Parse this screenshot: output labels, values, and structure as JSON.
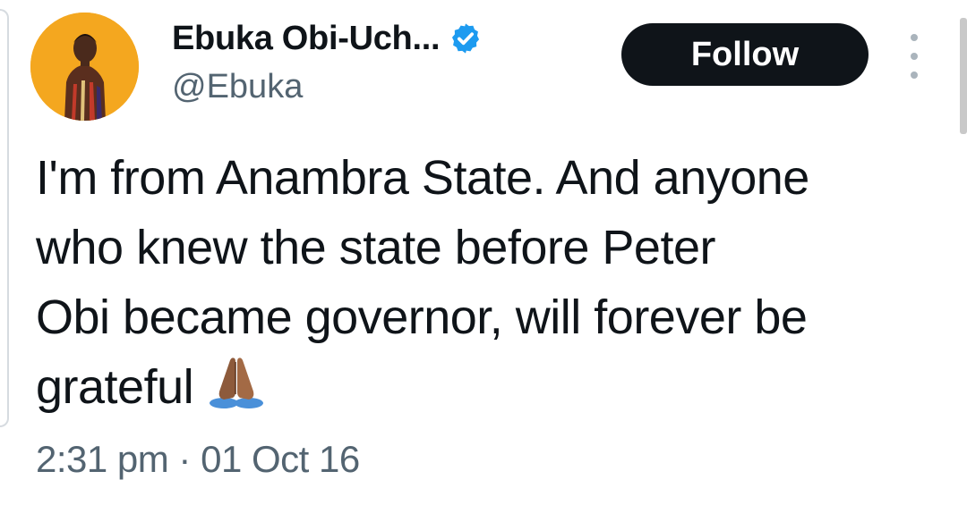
{
  "tweet": {
    "author": {
      "display_name": "Ebuka Obi-Uch...",
      "handle": "@Ebuka",
      "verified_icon": "verified-badge-icon",
      "avatar_icon": "avatar-photo"
    },
    "follow_label": "Follow",
    "more_icon": "more-vertical-icon",
    "text_lines": [
      "I'm from Anambra State. And anyone",
      "who knew the state before Peter",
      "Obi became governor, will forever be",
      "grateful"
    ],
    "emoji_icon": "folded-hands-icon",
    "timestamp": "2:31 pm · 01 Oct 16"
  },
  "colors": {
    "text_primary": "#0f1419",
    "text_secondary": "#536471",
    "verified_blue": "#1d9bf0",
    "button_bg": "#0f1419",
    "avatar_bg": "#f4a71f"
  }
}
